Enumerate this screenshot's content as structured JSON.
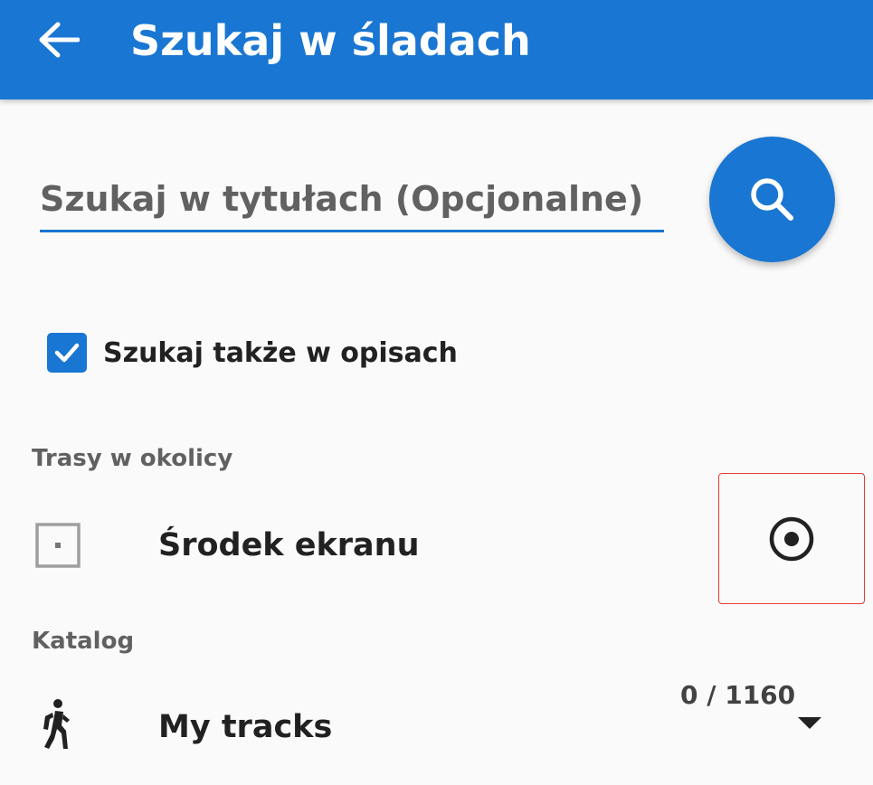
{
  "appbar": {
    "title": "Szukaj w śladach",
    "back_icon": "arrow-left-icon",
    "color": "#1976d2"
  },
  "search": {
    "placeholder": "Szukaj w tytułach (Opcjonalne)",
    "value": "",
    "button_icon": "search-icon"
  },
  "options": {
    "search_descriptions_label": "Szukaj także w opisach",
    "search_descriptions_checked": true
  },
  "nearby": {
    "header": "Trasy w okolicy",
    "item_label": "Środek ekranu",
    "item_icon": "screen-center-icon",
    "radio_icon": "radio-selected-icon",
    "selected": true
  },
  "catalog": {
    "header": "Katalog",
    "item_label": "My tracks",
    "item_icon": "hiking-icon",
    "count": "0 / 1160",
    "dropdown_icon": "caret-down-icon"
  }
}
